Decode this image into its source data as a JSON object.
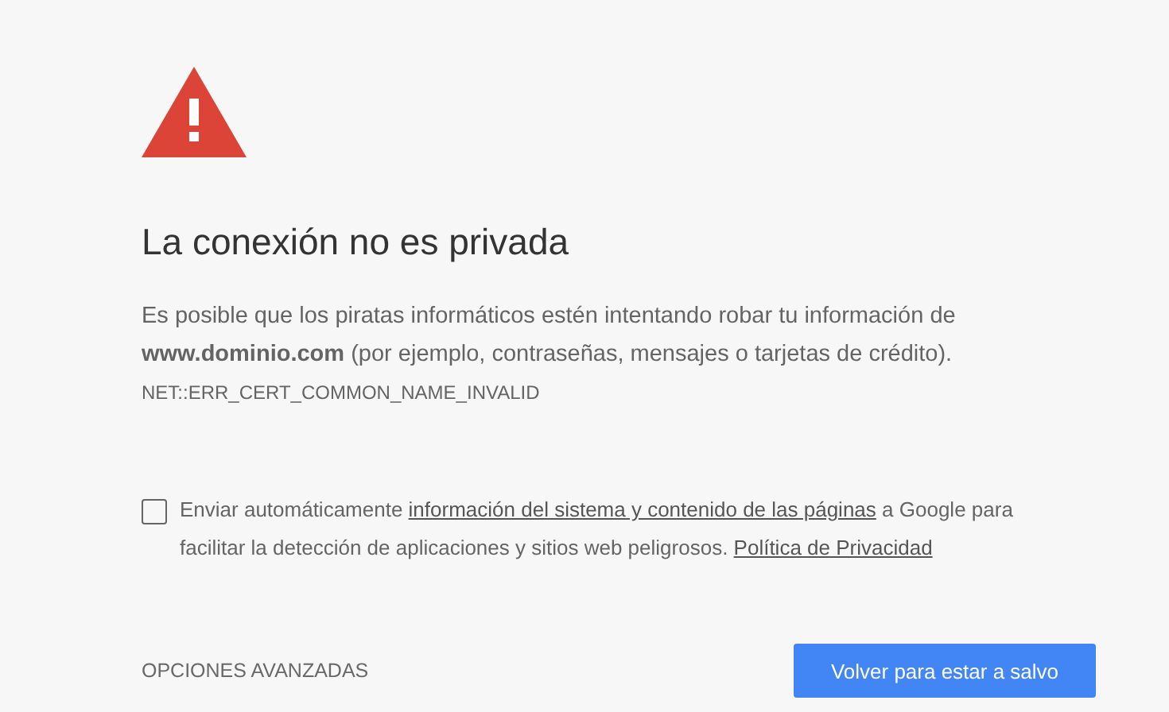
{
  "title": "La conexión no es privada",
  "message": "Es posible que los piratas informáticos estén intentando robar tu información de **www.dominio.com** (por ejemplo, contraseñas, mensajes o tarjetas de crédito).",
  "error_code": "NET::ERR_CERT_COMMON_NAME_INVALID",
  "report": {
    "checked": false,
    "parts": [
      {
        "kind": "text",
        "text": "Enviar automáticamente "
      },
      {
        "kind": "link",
        "text": "información del sistema y contenido de las páginas"
      },
      {
        "kind": "text",
        "text": " a Google para facilitar la detección de aplicaciones y sitios web peligrosos. "
      },
      {
        "kind": "link",
        "text": "Política de Privacidad"
      }
    ]
  },
  "advanced_button": "OPCIONES AVANZADAS",
  "primary_button": "Volver para estar a salvo"
}
